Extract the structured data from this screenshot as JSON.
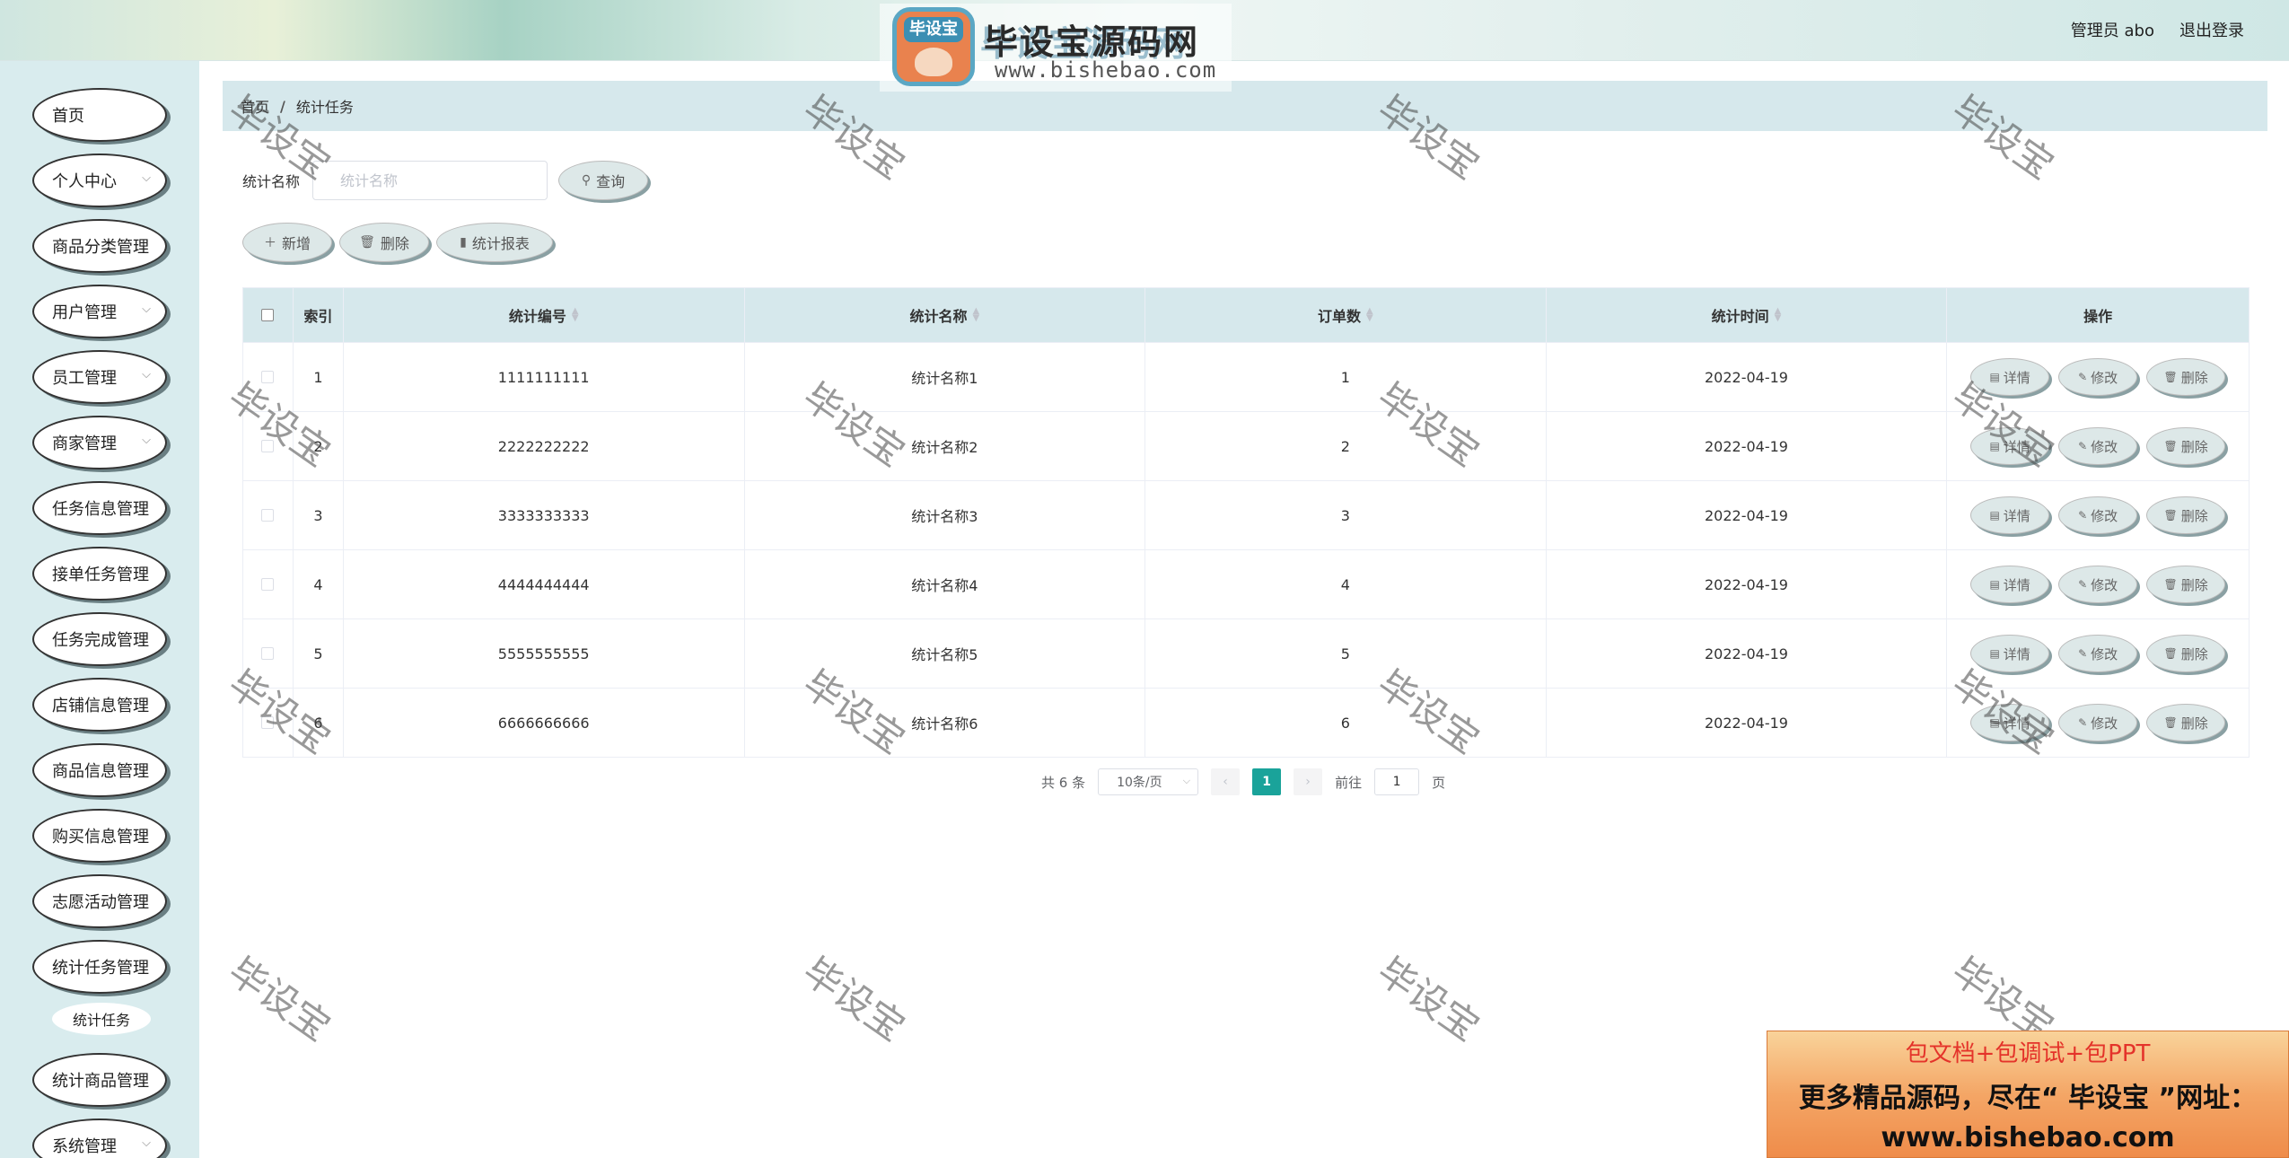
{
  "header": {
    "logo_badge": "毕设宝",
    "title": "毕设宝源码网",
    "url": "www.bishebao.com",
    "user": "管理员 abo",
    "logout": "退出登录"
  },
  "sidebar": {
    "items": [
      {
        "label": "首页",
        "chevron": false
      },
      {
        "label": "个人中心",
        "chevron": true
      },
      {
        "label": "商品分类管理",
        "chevron": false
      },
      {
        "label": "用户管理",
        "chevron": true
      },
      {
        "label": "员工管理",
        "chevron": true
      },
      {
        "label": "商家管理",
        "chevron": true
      },
      {
        "label": "任务信息管理",
        "chevron": false
      },
      {
        "label": "接单任务管理",
        "chevron": false
      },
      {
        "label": "任务完成管理",
        "chevron": false
      },
      {
        "label": "店铺信息管理",
        "chevron": false
      },
      {
        "label": "商品信息管理",
        "chevron": false
      },
      {
        "label": "购买信息管理",
        "chevron": false
      },
      {
        "label": "志愿活动管理",
        "chevron": false
      },
      {
        "label": "统计任务管理",
        "chevron": false
      },
      {
        "label": "统计商品管理",
        "chevron": false
      },
      {
        "label": "系统管理",
        "chevron": true
      }
    ],
    "sub_item": "统计任务"
  },
  "breadcrumb": {
    "home": "首页",
    "sep": "/",
    "current": "统计任务"
  },
  "search": {
    "label": "统计名称",
    "placeholder": "统计名称",
    "button": "查询"
  },
  "actions": {
    "add": "新增",
    "delete": "删除",
    "report": "统计报表"
  },
  "table": {
    "headers": {
      "index": "索引",
      "no": "统计编号",
      "name": "统计名称",
      "count": "订单数",
      "time": "统计时间",
      "ops": "操作"
    },
    "op_labels": {
      "detail": "详情",
      "edit": "修改",
      "delete": "删除"
    },
    "rows": [
      {
        "index": "1",
        "no": "1111111111",
        "name": "统计名称1",
        "count": "1",
        "time": "2022-04-19"
      },
      {
        "index": "2",
        "no": "2222222222",
        "name": "统计名称2",
        "count": "2",
        "time": "2022-04-19"
      },
      {
        "index": "3",
        "no": "3333333333",
        "name": "统计名称3",
        "count": "3",
        "time": "2022-04-19"
      },
      {
        "index": "4",
        "no": "4444444444",
        "name": "统计名称4",
        "count": "4",
        "time": "2022-04-19"
      },
      {
        "index": "5",
        "no": "5555555555",
        "name": "统计名称5",
        "count": "5",
        "time": "2022-04-19"
      },
      {
        "index": "6",
        "no": "6666666666",
        "name": "统计名称6",
        "count": "6",
        "time": "2022-04-19"
      }
    ]
  },
  "pagination": {
    "total": "共 6 条",
    "page_size": "10条/页",
    "current": "1",
    "goto_label": "前往",
    "goto_value": "1",
    "page_unit": "页"
  },
  "watermark": "毕设宝",
  "promo": {
    "line1": "包文档+包调试+包PPT",
    "line2": "更多精品源码，尽在“ 毕设宝 ”网址：",
    "line3": "www.bishebao.com"
  },
  "colors": {
    "accent": "#1aa39a",
    "sidebar_bg": "#d9ecee",
    "table_header_bg": "#d6e8ec"
  }
}
